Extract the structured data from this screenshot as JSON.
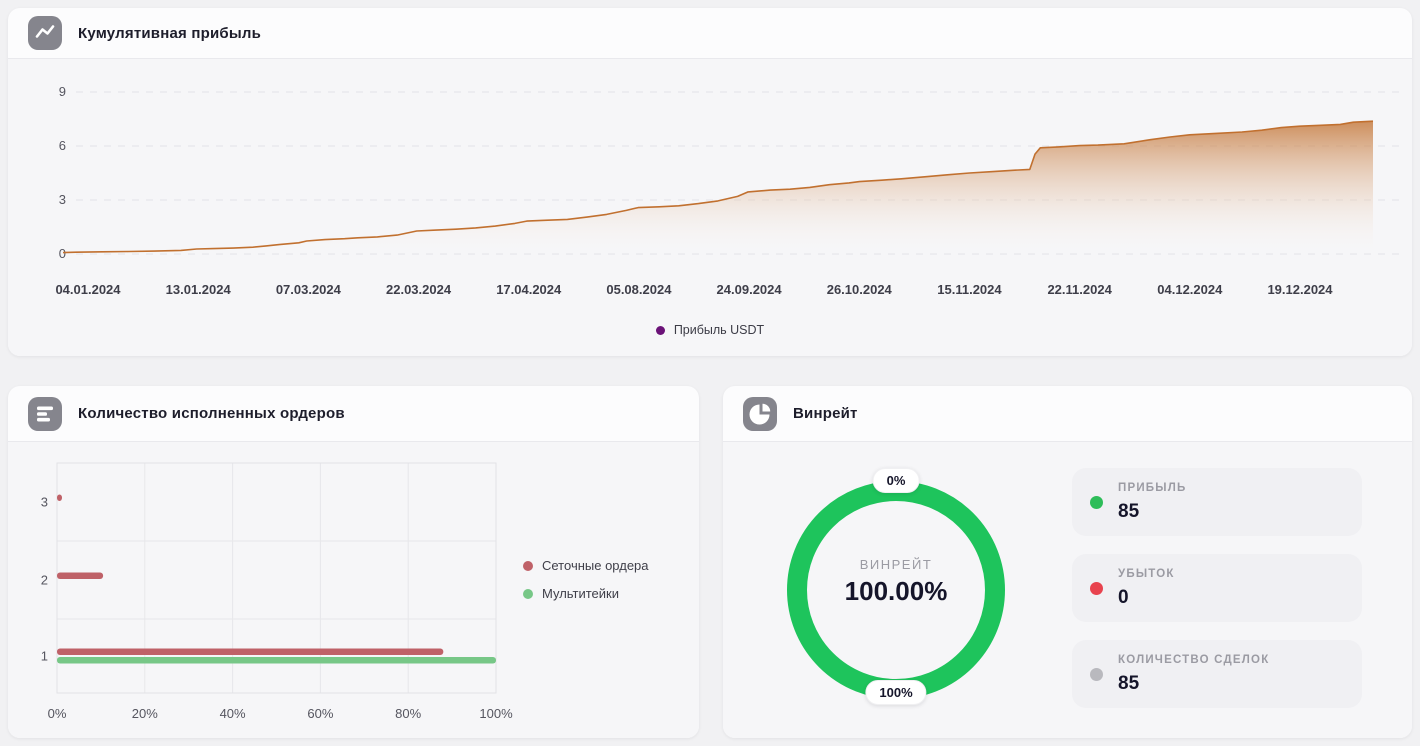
{
  "icons": {
    "cumulative": "trend-line-icon",
    "orders": "bar-chart-icon",
    "winrate": "pie-chart-icon"
  },
  "chart_data": [
    {
      "type": "area",
      "title": "Кумулятивная прибыль",
      "series_name": "Прибыль USDT",
      "legend_dot_color": "#6b1278",
      "line_color": "#c1702f",
      "y_ticks": [
        9,
        6,
        3,
        0
      ],
      "ylim": [
        0,
        9
      ],
      "grid": "dashed-horizontal",
      "legend_position": "bottom-center",
      "x_tick_labels": [
        "04.01.2024",
        "13.01.2024",
        "07.03.2024",
        "22.03.2024",
        "17.04.2024",
        "05.08.2024",
        "24.09.2024",
        "26.10.2024",
        "15.11.2024",
        "22.11.2024",
        "04.12.2024",
        "19.12.2024"
      ],
      "points": [
        [
          0.0,
          0.08
        ],
        [
          0.01,
          0.1
        ],
        [
          0.03,
          0.12
        ],
        [
          0.05,
          0.14
        ],
        [
          0.07,
          0.16
        ],
        [
          0.09,
          0.2
        ],
        [
          0.102,
          0.28
        ],
        [
          0.115,
          0.3
        ],
        [
          0.13,
          0.33
        ],
        [
          0.145,
          0.38
        ],
        [
          0.155,
          0.45
        ],
        [
          0.165,
          0.52
        ],
        [
          0.18,
          0.62
        ],
        [
          0.186,
          0.72
        ],
        [
          0.2,
          0.8
        ],
        [
          0.215,
          0.85
        ],
        [
          0.225,
          0.9
        ],
        [
          0.24,
          0.95
        ],
        [
          0.255,
          1.05
        ],
        [
          0.27,
          1.28
        ],
        [
          0.285,
          1.33
        ],
        [
          0.3,
          1.38
        ],
        [
          0.315,
          1.45
        ],
        [
          0.33,
          1.55
        ],
        [
          0.345,
          1.7
        ],
        [
          0.354,
          1.83
        ],
        [
          0.37,
          1.88
        ],
        [
          0.385,
          1.92
        ],
        [
          0.4,
          2.05
        ],
        [
          0.415,
          2.2
        ],
        [
          0.43,
          2.42
        ],
        [
          0.439,
          2.58
        ],
        [
          0.455,
          2.62
        ],
        [
          0.47,
          2.68
        ],
        [
          0.485,
          2.8
        ],
        [
          0.5,
          2.95
        ],
        [
          0.515,
          3.2
        ],
        [
          0.523,
          3.45
        ],
        [
          0.54,
          3.55
        ],
        [
          0.555,
          3.6
        ],
        [
          0.57,
          3.7
        ],
        [
          0.585,
          3.85
        ],
        [
          0.6,
          3.95
        ],
        [
          0.608,
          4.02
        ],
        [
          0.625,
          4.1
        ],
        [
          0.64,
          4.18
        ],
        [
          0.66,
          4.3
        ],
        [
          0.675,
          4.4
        ],
        [
          0.692,
          4.5
        ],
        [
          0.71,
          4.58
        ],
        [
          0.725,
          4.65
        ],
        [
          0.738,
          4.7
        ],
        [
          0.742,
          5.55
        ],
        [
          0.746,
          5.9
        ],
        [
          0.76,
          5.95
        ],
        [
          0.776,
          6.02
        ],
        [
          0.79,
          6.05
        ],
        [
          0.81,
          6.12
        ],
        [
          0.83,
          6.35
        ],
        [
          0.845,
          6.5
        ],
        [
          0.86,
          6.62
        ],
        [
          0.88,
          6.7
        ],
        [
          0.9,
          6.78
        ],
        [
          0.915,
          6.88
        ],
        [
          0.93,
          7.02
        ],
        [
          0.944,
          7.1
        ],
        [
          0.96,
          7.15
        ],
        [
          0.975,
          7.2
        ],
        [
          0.985,
          7.32
        ],
        [
          1.0,
          7.38
        ]
      ]
    },
    {
      "type": "bar",
      "title": "Количество исполненных ордеров",
      "orientation": "horizontal",
      "categories": [
        "3",
        "2",
        "1"
      ],
      "x_ticks": [
        "0%",
        "20%",
        "40%",
        "60%",
        "80%",
        "100%"
      ],
      "xlim": [
        0,
        100
      ],
      "grid": "on",
      "legend_position": "right",
      "series": [
        {
          "name": "Сеточные ордера",
          "color": "#bf6168",
          "values": [
            1,
            10.5,
            88
          ]
        },
        {
          "name": "Мультитейки",
          "color": "#77c787",
          "values": [
            0,
            0,
            100
          ]
        }
      ]
    },
    {
      "type": "donut",
      "title": "Винрейт",
      "label": "ВИНРЕЙТ",
      "value": "100.00%",
      "percent": 100,
      "top_marker": "0%",
      "bottom_marker": "100%",
      "color": "#1ec45c",
      "stats": [
        {
          "label": "ПРИБЫЛЬ",
          "value": "85",
          "dot_color": "#2ebd59"
        },
        {
          "label": "УБЫТОК",
          "value": "0",
          "dot_color": "#e8434e"
        },
        {
          "label": "КОЛИЧЕСТВО СДЕЛОК",
          "value": "85",
          "dot_color": "#b9b9be"
        }
      ]
    }
  ]
}
